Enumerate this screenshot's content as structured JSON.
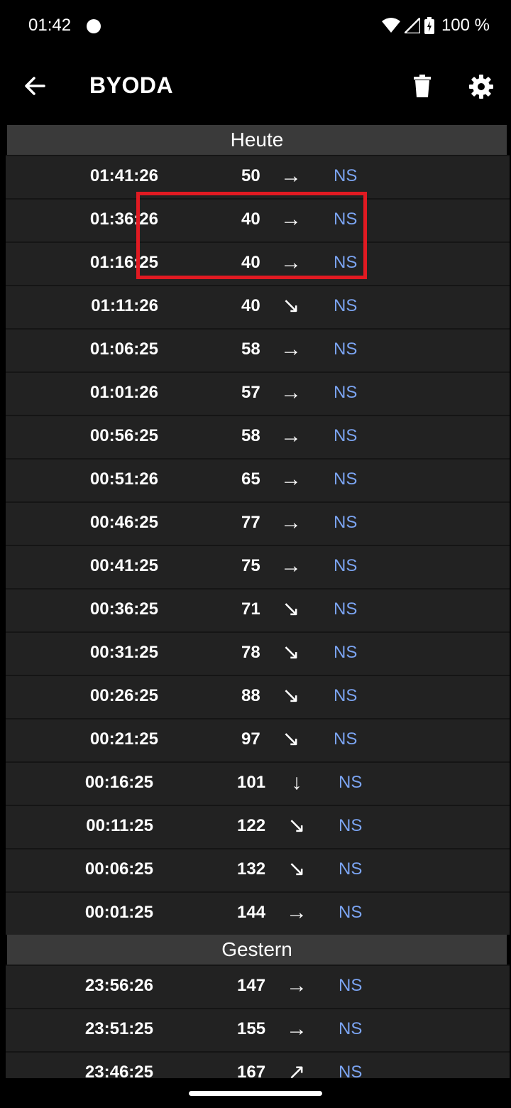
{
  "status_bar": {
    "time": "01:42",
    "battery_text": "100 %",
    "wear_icon": "wear-os-icon",
    "wifi_icon": "wifi-icon",
    "signal_icon": "cell-signal-icon",
    "battery_icon": "battery-charging-icon"
  },
  "app_bar": {
    "title": "BYODA",
    "back_icon": "arrow-left-icon",
    "trash_icon": "trash-icon",
    "settings_icon": "gear-icon"
  },
  "sections": [
    {
      "header": "Heute",
      "entries": [
        {
          "time": "01:41:26",
          "value": "50",
          "trend": "→",
          "tag": "NS"
        },
        {
          "time": "01:36:26",
          "value": "40",
          "trend": "→",
          "tag": "NS"
        },
        {
          "time": "01:16:25",
          "value": "40",
          "trend": "→",
          "tag": "NS"
        },
        {
          "time": "01:11:26",
          "value": "40",
          "trend": "↘",
          "tag": "NS"
        },
        {
          "time": "01:06:25",
          "value": "58",
          "trend": "→",
          "tag": "NS"
        },
        {
          "time": "01:01:26",
          "value": "57",
          "trend": "→",
          "tag": "NS"
        },
        {
          "time": "00:56:25",
          "value": "58",
          "trend": "→",
          "tag": "NS"
        },
        {
          "time": "00:51:26",
          "value": "65",
          "trend": "→",
          "tag": "NS"
        },
        {
          "time": "00:46:25",
          "value": "77",
          "trend": "→",
          "tag": "NS"
        },
        {
          "time": "00:41:25",
          "value": "75",
          "trend": "→",
          "tag": "NS"
        },
        {
          "time": "00:36:25",
          "value": "71",
          "trend": "↘",
          "tag": "NS"
        },
        {
          "time": "00:31:25",
          "value": "78",
          "trend": "↘",
          "tag": "NS"
        },
        {
          "time": "00:26:25",
          "value": "88",
          "trend": "↘",
          "tag": "NS"
        },
        {
          "time": "00:21:25",
          "value": "97",
          "trend": "↘",
          "tag": "NS"
        },
        {
          "time": "00:16:25",
          "value": "101",
          "trend": "↓",
          "tag": "NS"
        },
        {
          "time": "00:11:25",
          "value": "122",
          "trend": "↘",
          "tag": "NS"
        },
        {
          "time": "00:06:25",
          "value": "132",
          "trend": "↘",
          "tag": "NS"
        },
        {
          "time": "00:01:25",
          "value": "144",
          "trend": "→",
          "tag": "NS"
        }
      ]
    },
    {
      "header": "Gestern",
      "entries": [
        {
          "time": "23:56:26",
          "value": "147",
          "trend": "→",
          "tag": "NS"
        },
        {
          "time": "23:51:25",
          "value": "155",
          "trend": "→",
          "tag": "NS"
        },
        {
          "time": "23:46:25",
          "value": "167",
          "trend": "↗",
          "tag": "NS"
        }
      ]
    }
  ],
  "colors": {
    "background": "#000000",
    "row": "#222222",
    "section_header": "#3a3a3a",
    "tag": "#7ba4f2",
    "highlight": "#e11a22"
  }
}
